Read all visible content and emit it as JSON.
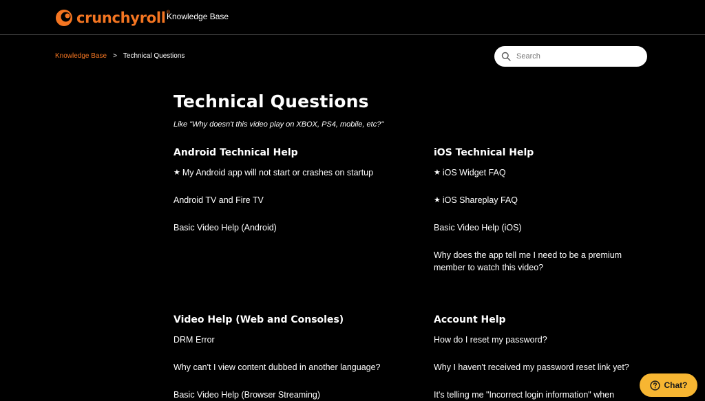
{
  "header": {
    "brand": "crunchyroll",
    "brand_mark": "®",
    "kb_link": "Knowledge Base"
  },
  "breadcrumb": {
    "root": "Knowledge Base",
    "separator": ">",
    "current": "Technical Questions"
  },
  "search": {
    "placeholder": "Search"
  },
  "page": {
    "title": "Technical Questions",
    "subtitle": "Like \"Why doesn't this video play on XBOX, PS4, mobile, etc?\""
  },
  "sections": {
    "android": {
      "title": "Android Technical Help",
      "items": [
        {
          "label": "My Android app will not start or crashes on startup",
          "starred": true
        },
        {
          "label": "Android TV and Fire TV",
          "starred": false
        },
        {
          "label": "Basic Video Help (Android)",
          "starred": false
        }
      ]
    },
    "ios": {
      "title": "iOS Technical Help",
      "items": [
        {
          "label": "iOS Widget FAQ",
          "starred": true
        },
        {
          "label": "iOS Shareplay FAQ",
          "starred": true
        },
        {
          "label": "Basic Video Help (iOS)",
          "starred": false
        },
        {
          "label": "Why does the app tell me I need to be a premium member to watch this video?",
          "starred": false
        }
      ]
    },
    "video": {
      "title": "Video Help (Web and Consoles)",
      "items": [
        {
          "label": "DRM Error",
          "starred": false
        },
        {
          "label": "Why can't I view content dubbed in another language?",
          "starred": false
        },
        {
          "label": "Basic Video Help (Browser Streaming)",
          "starred": false
        }
      ]
    },
    "account": {
      "title": "Account Help",
      "items": [
        {
          "label": "How do I reset my password?",
          "starred": false
        },
        {
          "label": "Why I haven't received my password reset link yet?",
          "starred": false
        },
        {
          "label": "It's telling me \"Incorrect login information\" when",
          "starred": false
        }
      ]
    }
  },
  "chat": {
    "label": "Chat?"
  },
  "colors": {
    "accent": "#f47521",
    "chat_bg": "#f7b632",
    "background": "#000000",
    "divider": "#4a4a4a"
  },
  "icons": {
    "logo": "crunchyroll-logo-icon",
    "search": "search-icon",
    "star": "star-icon",
    "chat": "help-circle-icon"
  }
}
